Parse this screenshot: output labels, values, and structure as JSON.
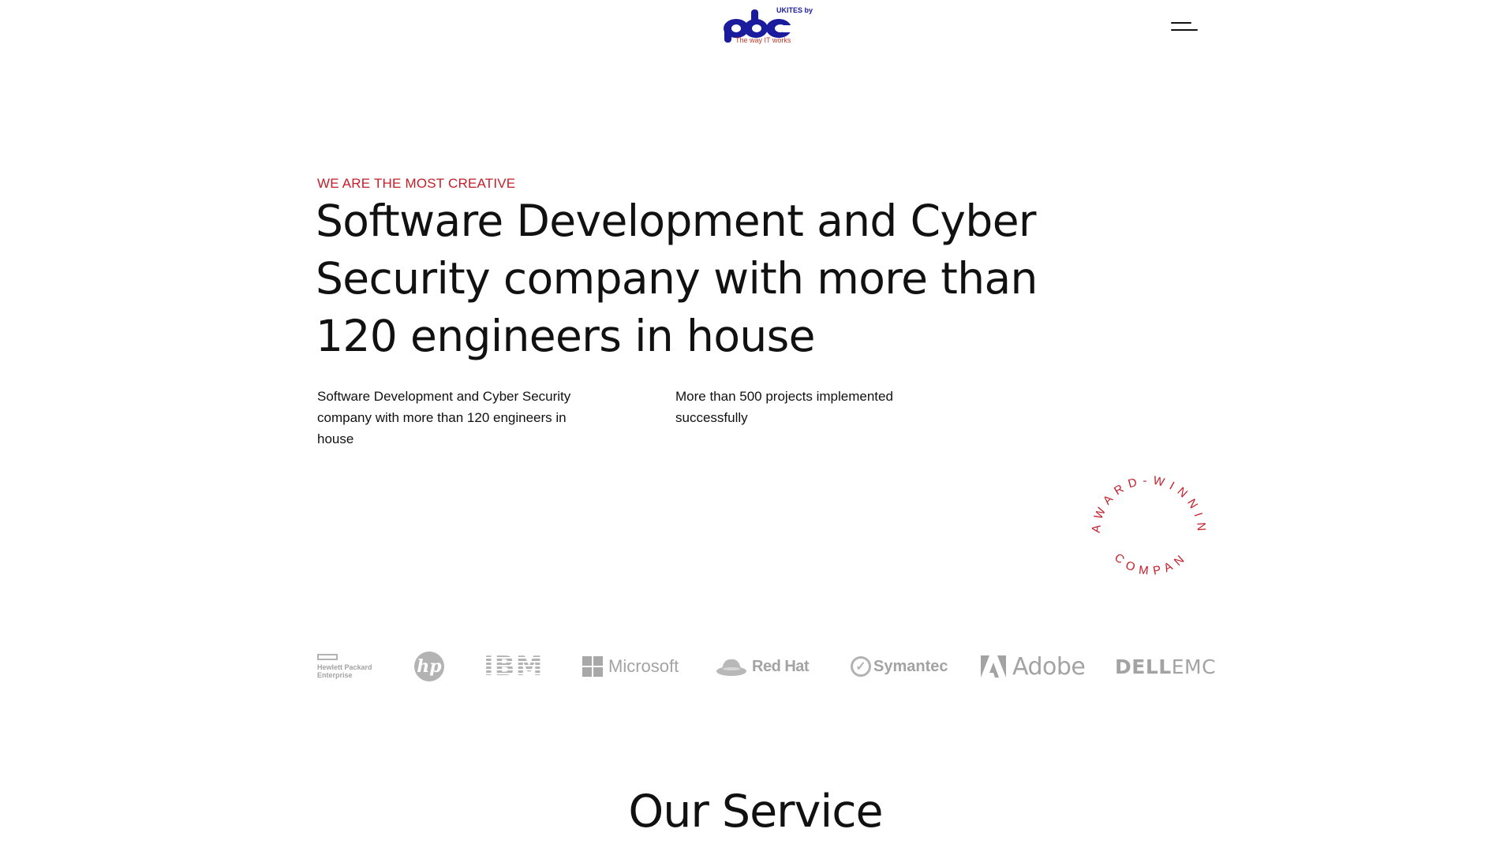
{
  "header": {
    "logo": {
      "top_text": "UKITES by",
      "wordmark": "pbc",
      "tagline": "The way IT works"
    },
    "menu_icon": "hamburger-menu-icon"
  },
  "hero": {
    "eyebrow": "WE ARE THE MOST CREATIVE",
    "headline": "Software Development and Cyber Security company with more than 120 engineers in house",
    "description_1": "Software Development and Cyber Security company with more than 120 engineers in house",
    "description_2": "More than 500 projects implemented successfully"
  },
  "award_badge": {
    "top_text": "AWARD-WINNING",
    "bottom_text": "COMPANY"
  },
  "clients": {
    "hpe": "Hewlett Packard Enterprise",
    "hp": "hp",
    "ibm": "IBM",
    "microsoft": "Microsoft",
    "redhat": "Red Hat",
    "symantec": "Symantec",
    "adobe": "Adobe",
    "dell_part1": "DELL",
    "dell_part2": "EMC"
  },
  "services": {
    "title": "Our Service"
  },
  "colors": {
    "accent_red": "#c41e2a",
    "logo_blue": "#1b1b9e",
    "text": "#111111",
    "logo_gray": "#a3a3a3"
  }
}
